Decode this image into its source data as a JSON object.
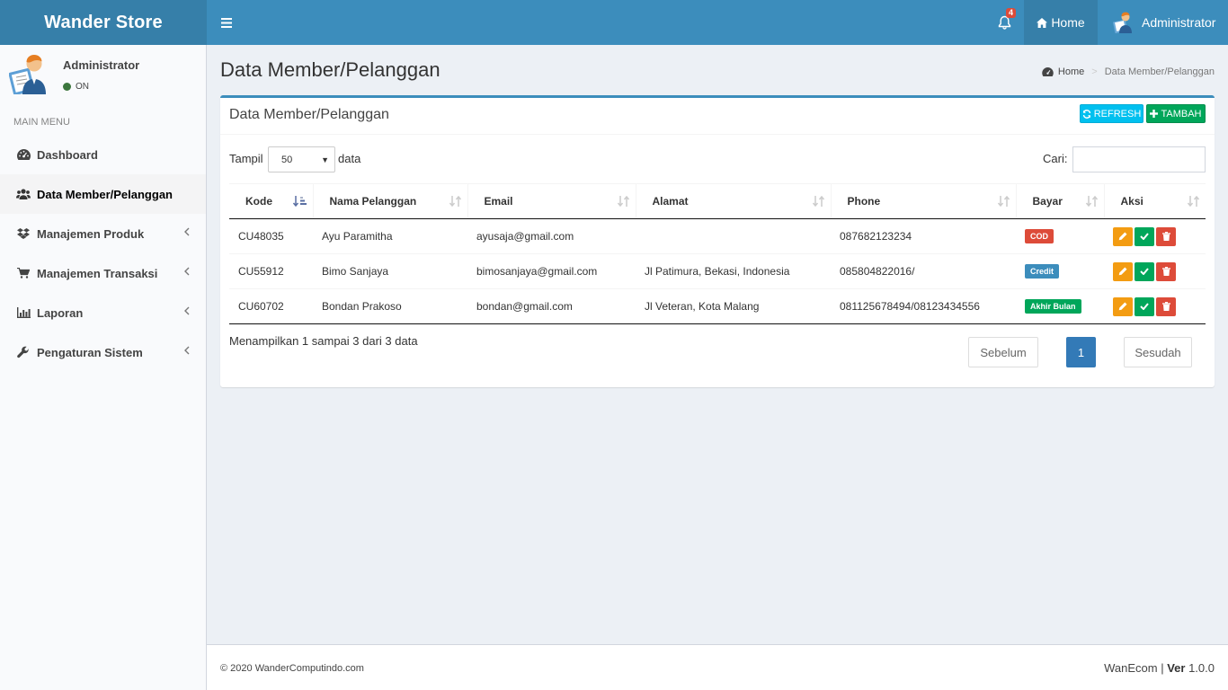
{
  "header": {
    "brand": "Wander Store",
    "notification_count": "4",
    "home_label": "Home",
    "user_label": "Administrator"
  },
  "sidebar": {
    "user_name": "Administrator",
    "user_status": "ON",
    "menu_header": "MAIN MENU",
    "items": [
      {
        "label": "Dashboard",
        "icon": "dashboard-icon"
      },
      {
        "label": "Data Member/Pelanggan",
        "icon": "users-icon"
      },
      {
        "label": "Manajemen Produk",
        "icon": "dropbox-icon"
      },
      {
        "label": "Manajemen Transaksi",
        "icon": "cart-icon"
      },
      {
        "label": "Laporan",
        "icon": "bar-chart-icon"
      },
      {
        "label": "Pengaturan Sistem",
        "icon": "wrench-icon"
      }
    ]
  },
  "page": {
    "title": "Data Member/Pelanggan",
    "breadcrumb": {
      "home": "Home",
      "current": "Data Member/Pelanggan"
    }
  },
  "box": {
    "title": "Data Member/Pelanggan",
    "refresh_label": "REFRESH",
    "add_label": "TAMBAH",
    "length_label": "Tampil",
    "length_value": "50",
    "length_suffix": "data",
    "search_label": "Cari:",
    "search_value": ""
  },
  "table": {
    "columns": [
      "Kode",
      "Nama Pelanggan",
      "Email",
      "Alamat",
      "Phone",
      "Bayar",
      "Aksi"
    ],
    "rows": [
      {
        "kode": "CU48035",
        "nama": "Ayu Paramitha",
        "email": "ayusaja@gmail.com",
        "alamat": "",
        "phone": "087682123234",
        "bayar": "COD",
        "bayar_color": "#dd4b39"
      },
      {
        "kode": "CU55912",
        "nama": "Bimo Sanjaya",
        "email": "bimosanjaya@gmail.com",
        "alamat": "Jl Patimura, Bekasi, Indonesia",
        "phone": "085804822016/",
        "bayar": "Credit",
        "bayar_color": "#3c8dbc"
      },
      {
        "kode": "CU60702",
        "nama": "Bondan Prakoso",
        "email": "bondan@gmail.com",
        "alamat": "Jl Veteran, Kota Malang",
        "phone": "081125678494/08123434556",
        "bayar": "Akhir Bulan",
        "bayar_color": "#00a65a"
      }
    ],
    "info": "Menampilkan 1 sampai 3 dari 3 data",
    "prev_label": "Sebelum",
    "current_page": "1",
    "next_label": "Sesudah"
  },
  "footer": {
    "copyright": "© 2020  WanderComputindo.com",
    "app_name": "WanEcom |",
    "version_label": "Ver",
    "version": "1.0.0"
  },
  "colors": {
    "header": "#3c8dbc",
    "logo_bg": "#367fa9",
    "edit": "#f39c12",
    "confirm": "#00a65a",
    "delete": "#dd4b39"
  }
}
